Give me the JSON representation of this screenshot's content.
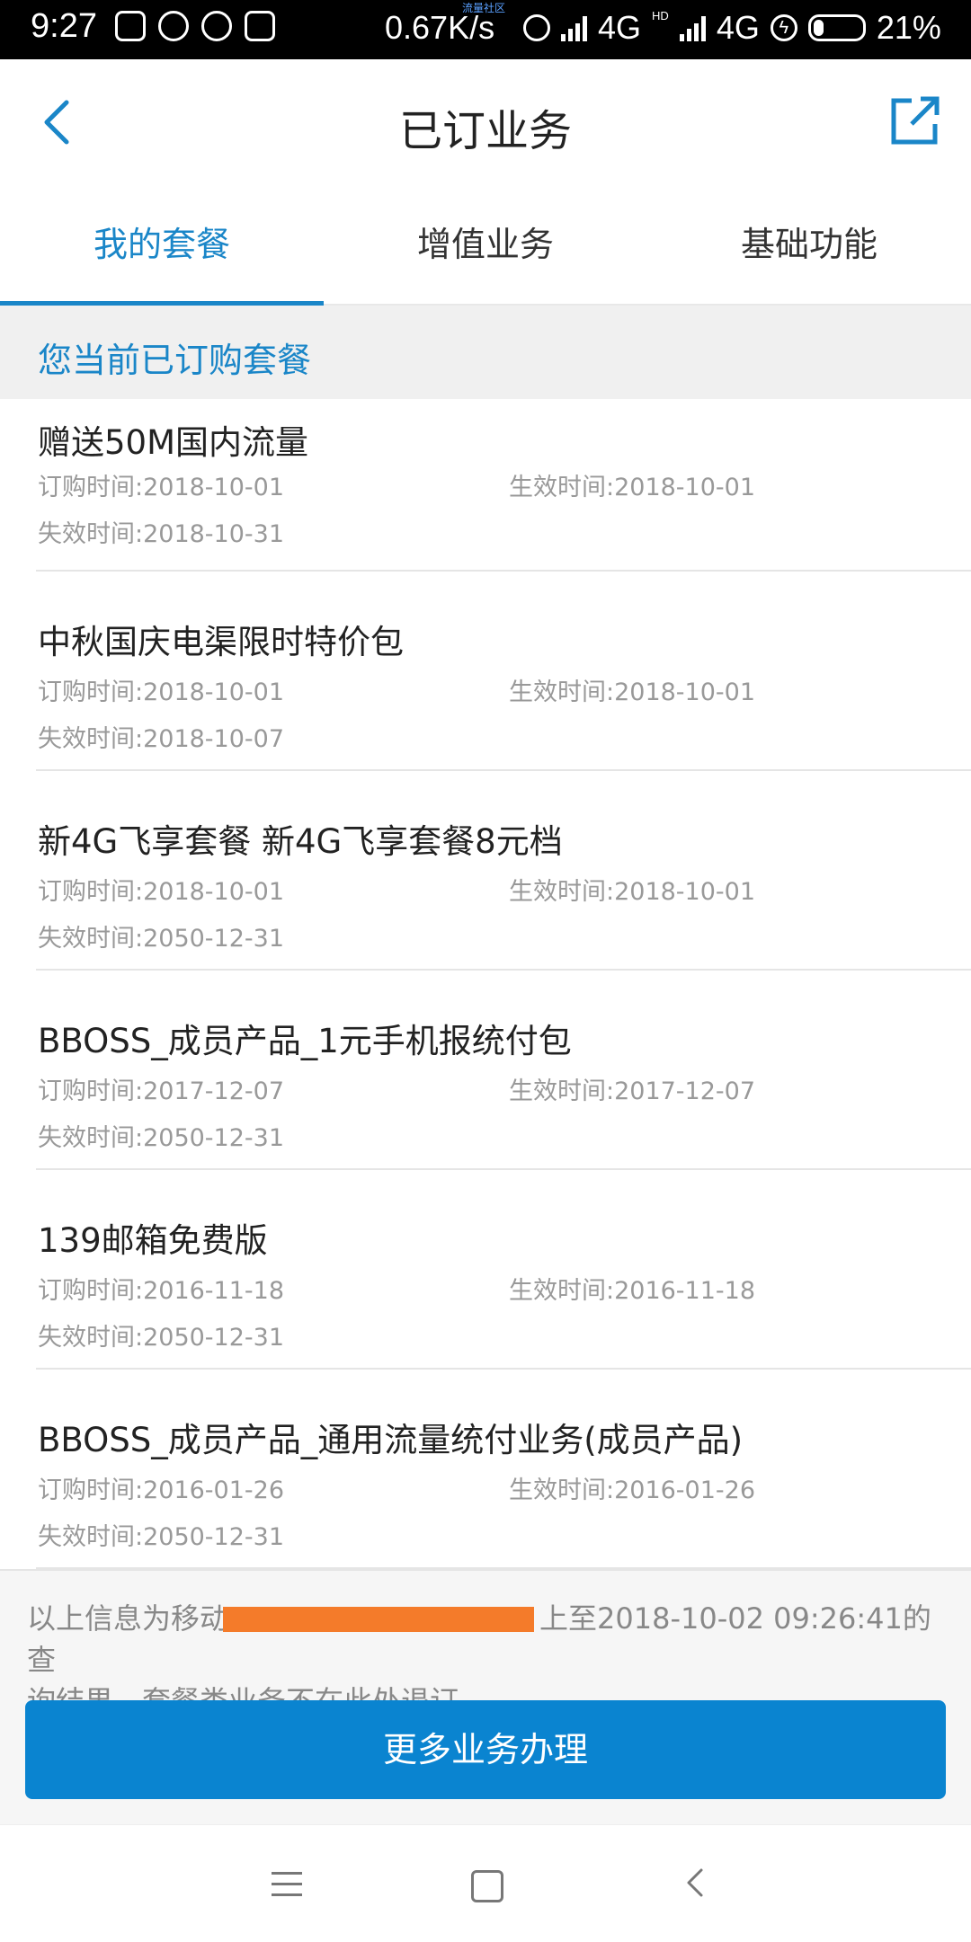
{
  "status_bar": {
    "time": "9:27",
    "carrier_tag": "流量社区",
    "net_speed": "0.67K/s",
    "network1": "4G",
    "hd_label": "HD",
    "network2": "4G",
    "battery_percent": "21%",
    "battery_level": 0.21,
    "icons": [
      "message-icon",
      "app-icon",
      "weibo-icon",
      "notes-icon",
      "alarm-icon",
      "signal-icon",
      "charging-icon",
      "battery-icon"
    ]
  },
  "header": {
    "title": "已订业务",
    "back_icon": "chevron-left-icon",
    "share_icon": "share-external-icon",
    "accent_color": "#1a86c8"
  },
  "tabs": [
    {
      "label": "我的套餐",
      "active": true
    },
    {
      "label": "增值业务",
      "active": false
    },
    {
      "label": "基础功能",
      "active": false
    }
  ],
  "section": {
    "title": "您当前已订购套餐"
  },
  "packages": [
    {
      "name": "赠送50M国内流量",
      "order_time": "订购时间:2018-10-01",
      "effective_time": "生效时间:2018-10-01",
      "expire_time": "失效时间:2018-10-31"
    },
    {
      "name": "中秋国庆电渠限时特价包",
      "order_time": "订购时间:2018-10-01",
      "effective_time": "生效时间:2018-10-01",
      "expire_time": "失效时间:2018-10-07"
    },
    {
      "name": "新4G飞享套餐 新4G飞享套餐8元档",
      "order_time": "订购时间:2018-10-01",
      "effective_time": "生效时间:2018-10-01",
      "expire_time": "失效时间:2050-12-31"
    },
    {
      "name": "BBOSS_成员产品_1元手机报统付包",
      "order_time": "订购时间:2017-12-07",
      "effective_time": "生效时间:2017-12-07",
      "expire_time": "失效时间:2050-12-31"
    },
    {
      "name": "139邮箱免费版",
      "order_time": "订购时间:2016-11-18",
      "effective_time": "生效时间:2016-11-18",
      "expire_time": "失效时间:2050-12-31"
    },
    {
      "name": "BBOSS_成员产品_通用流量统付业务(成员产品)",
      "order_time": "订购时间:2016-01-26",
      "effective_time": "生效时间:2016-01-26",
      "expire_time": "失效时间:2050-12-31"
    }
  ],
  "footer": {
    "notice_line1_prefix": "以上信息为移动",
    "notice_line1_suffix": "上至2018-10-02 09:26:41的查",
    "notice_line2": "询结果，套餐类业务不在此处退订",
    "redaction_color": "#f47b2a",
    "button_label": "更多业务办理",
    "button_color": "#0a84d0"
  },
  "nav_bar": {
    "icons": [
      "menu-icon",
      "home-icon",
      "back-icon"
    ]
  }
}
